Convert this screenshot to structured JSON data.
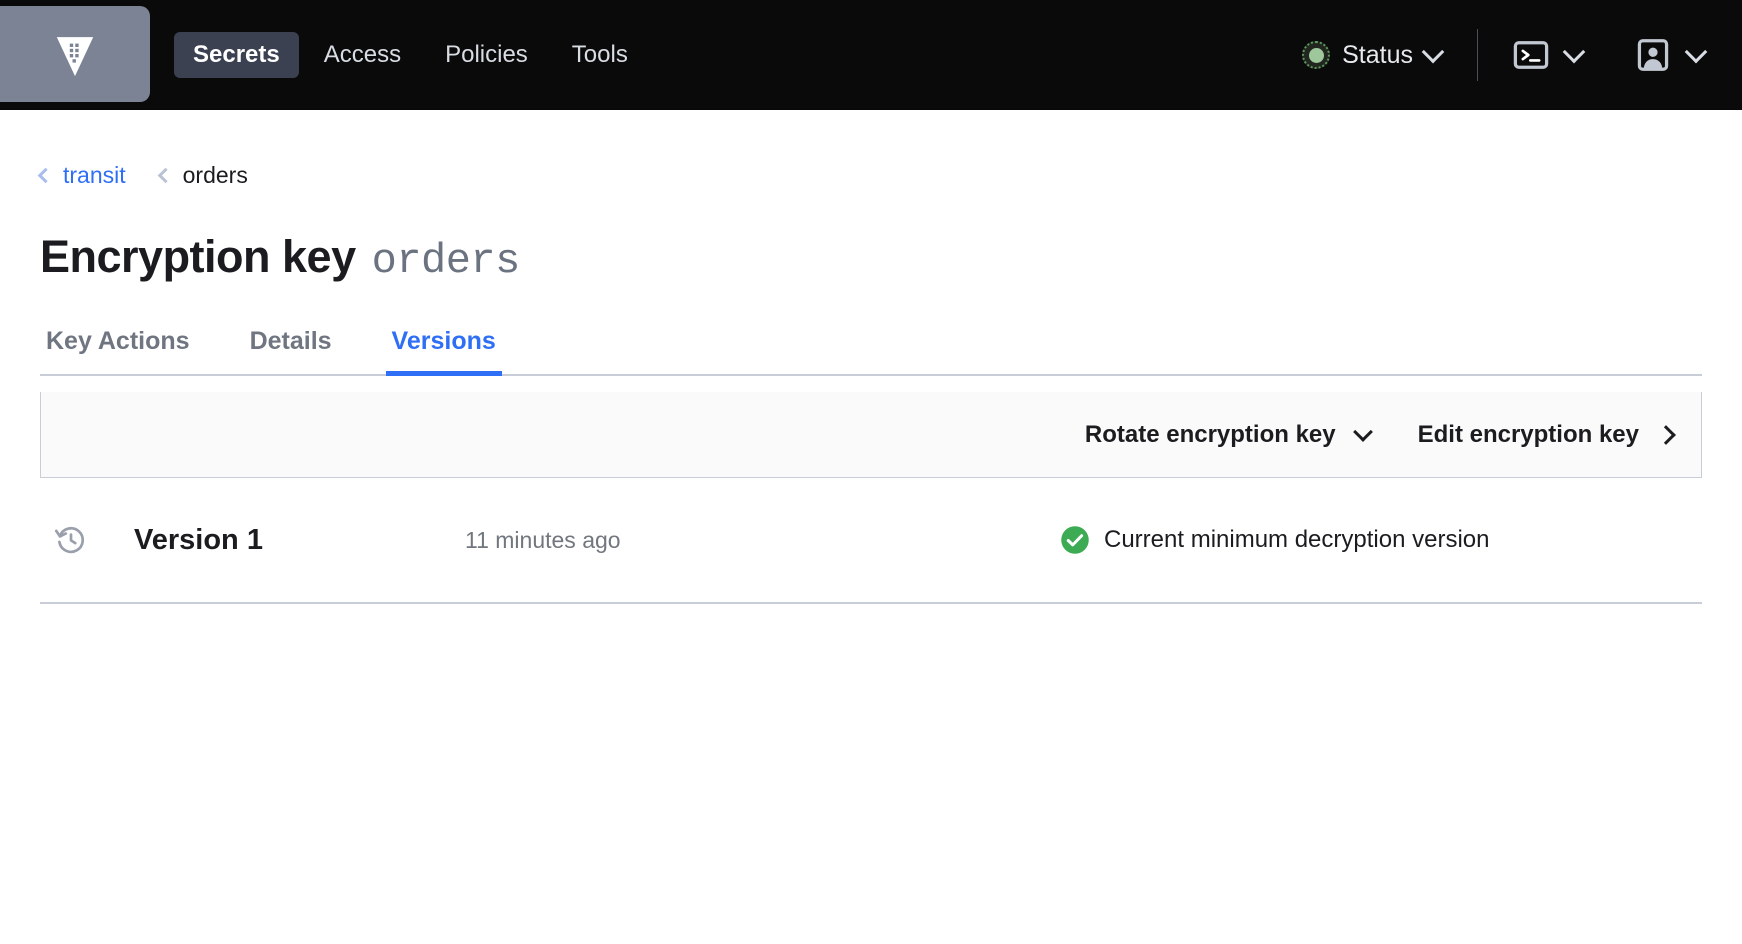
{
  "navbar": {
    "logo_icon": "vault-logo-icon",
    "items": [
      {
        "label": "Secrets",
        "active": true
      },
      {
        "label": "Access",
        "active": false
      },
      {
        "label": "Policies",
        "active": false
      },
      {
        "label": "Tools",
        "active": false
      }
    ],
    "status": {
      "label": "Status",
      "indicator_icon": "status-dot-icon",
      "indicator_color": "#9ec89b",
      "chevron_icon": "chevron-down-icon"
    },
    "console": {
      "icon": "terminal-icon",
      "chevron_icon": "chevron-down-icon"
    },
    "user": {
      "icon": "user-avatar-icon",
      "chevron_icon": "chevron-down-icon"
    }
  },
  "breadcrumb": {
    "chevron_icon": "chevron-left-icon",
    "items": [
      {
        "label": "transit",
        "link": true
      },
      {
        "label": "orders",
        "link": false
      }
    ]
  },
  "page": {
    "title_prefix": "Encryption key",
    "title_name": "orders"
  },
  "tabs": [
    {
      "label": "Key Actions",
      "active": false
    },
    {
      "label": "Details",
      "active": false
    },
    {
      "label": "Versions",
      "active": true
    }
  ],
  "toolbar": {
    "rotate_label": "Rotate encryption key",
    "rotate_chevron_icon": "chevron-down-icon",
    "edit_label": "Edit encryption key",
    "edit_chevron_icon": "chevron-right-icon"
  },
  "versions": [
    {
      "icon": "history-rotate-icon",
      "name": "Version 1",
      "time": "11 minutes ago",
      "status_icon": "check-circle-icon",
      "status_color": "#3cab54",
      "status_text": "Current minimum decryption version"
    }
  ],
  "colors": {
    "accent_blue": "#2f6ff5",
    "nav_background": "#0a0a0a",
    "logo_tile": "#7c8395",
    "success_green": "#3cab54",
    "border_gray": "#c9cdd8"
  }
}
